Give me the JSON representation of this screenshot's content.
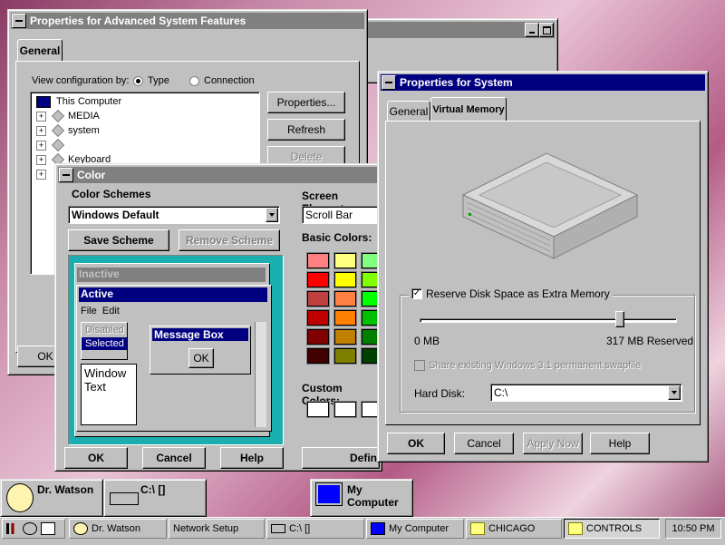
{
  "adv_window": {
    "title": "Properties for Advanced System Features",
    "tab": "General",
    "view_by_label": "View configuration by:",
    "radio_type": "Type",
    "radio_connection": "Connection",
    "tree": [
      "This Computer",
      "MEDIA",
      "system",
      "",
      "Keyboard"
    ],
    "btn_properties": "Properties...",
    "btn_refresh": "Refresh",
    "btn_delete": "Delete",
    "btn_ok": "OK"
  },
  "color_window": {
    "title": "Color",
    "schemes_label": "Color Schemes",
    "scheme_value": "Windows Default",
    "save_scheme": "Save Scheme",
    "remove_scheme": "Remove Scheme",
    "preview": {
      "inactive": "Inactive",
      "active": "Active",
      "menu_file": "File",
      "menu_edit": "Edit",
      "disabled": "Disabled",
      "selected": "Selected",
      "message_box": "Message Box",
      "ok": "OK",
      "window_text": "Window Text"
    },
    "screen_element_label": "Screen Element",
    "screen_element_value": "Scroll Bar",
    "basic_colors_label": "Basic Colors:",
    "basic_colors": [
      "#ff8080",
      "#ffff80",
      "#80ff80",
      "#ff0000",
      "#ffff00",
      "#80ff00",
      "#c04040",
      "#ff8040",
      "#00ff00",
      "#c00000",
      "#ff8000",
      "#00c000",
      "#800000",
      "#c08000",
      "#008000",
      "#400000",
      "#808000",
      "#004000"
    ],
    "custom_colors_label": "Custom Colors:",
    "btn_ok": "OK",
    "btn_cancel": "Cancel",
    "btn_help": "Help",
    "btn_define": "Defin"
  },
  "sys_window": {
    "title": "Properties for System",
    "tab_general": "General",
    "tab_vm": "Virtual Memory",
    "reserve_label": "Reserve Disk Space as Extra Memory",
    "reserve_checked": true,
    "slider_min": "0 MB",
    "slider_max": "317 MB Reserved",
    "slider_fraction": 0.78,
    "share_label": "Share existing Windows 3.1 permanent swapfile",
    "hard_disk_label": "Hard Disk:",
    "hard_disk_value": "C:\\",
    "btn_ok": "OK",
    "btn_cancel": "Cancel",
    "btn_apply": "Apply Now",
    "btn_help": "Help"
  },
  "desktop": {
    "drwatson": "Dr. Watson",
    "cdrive": "C:\\ []",
    "mycomputer": "My Computer"
  },
  "taskbar": {
    "items": [
      "Dr. Watson",
      "Network Setup",
      "C:\\ []",
      "My Computer",
      "CHICAGO",
      "CONTROLS"
    ],
    "clock": "10:50 PM"
  }
}
